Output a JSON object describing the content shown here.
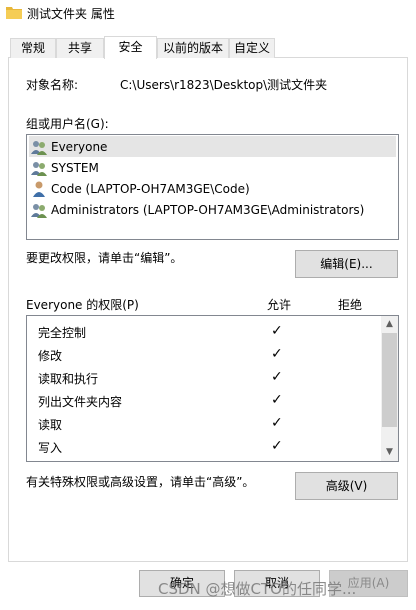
{
  "window": {
    "title": "测试文件夹 属性",
    "folder_icon": "folder-icon"
  },
  "tabs": [
    {
      "label": "常规",
      "active": false
    },
    {
      "label": "共享",
      "active": false
    },
    {
      "label": "安全",
      "active": true
    },
    {
      "label": "以前的版本",
      "active": false
    },
    {
      "label": "自定义",
      "active": false
    }
  ],
  "security": {
    "object_name_label": "对象名称:",
    "object_name_value": "C:\\Users\\r1823\\Desktop\\测试文件夹",
    "groups_label": "组或用户名(G):",
    "users": [
      {
        "name": "Everyone",
        "icon": "group-icon",
        "selected": true
      },
      {
        "name": "SYSTEM",
        "icon": "group-icon",
        "selected": false
      },
      {
        "name": "Code (LAPTOP-OH7AM3GE\\Code)",
        "icon": "user-icon",
        "selected": false
      },
      {
        "name": "Administrators (LAPTOP-OH7AM3GE\\Administrators)",
        "icon": "group-icon",
        "selected": false
      }
    ],
    "edit_hint": "要更改权限，请单击“编辑”。",
    "edit_button": "编辑(E)...",
    "permissions_label": "Everyone 的权限(P)",
    "allow_header": "允许",
    "deny_header": "拒绝",
    "permissions": [
      {
        "name": "完全控制",
        "allow": "✓",
        "deny": ""
      },
      {
        "name": "修改",
        "allow": "✓",
        "deny": ""
      },
      {
        "name": "读取和执行",
        "allow": "✓",
        "deny": ""
      },
      {
        "name": "列出文件夹内容",
        "allow": "✓",
        "deny": ""
      },
      {
        "name": "读取",
        "allow": "✓",
        "deny": ""
      },
      {
        "name": "写入",
        "allow": "✓",
        "deny": ""
      }
    ],
    "advanced_hint": "有关特殊权限或高级设置，请单击“高级”。",
    "advanced_button": "高级(V)"
  },
  "footer": {
    "ok_button": "确定",
    "cancel_button": "取消",
    "apply_button": "应用(A)"
  },
  "watermark": "CSDN @想做CTO的任同学...",
  "colors": {
    "selected_row": "#e5e5e5",
    "button_face": "#e1e1e1",
    "panel_border": "#d9d9d9",
    "folder_yellow": "#e8b73a"
  }
}
